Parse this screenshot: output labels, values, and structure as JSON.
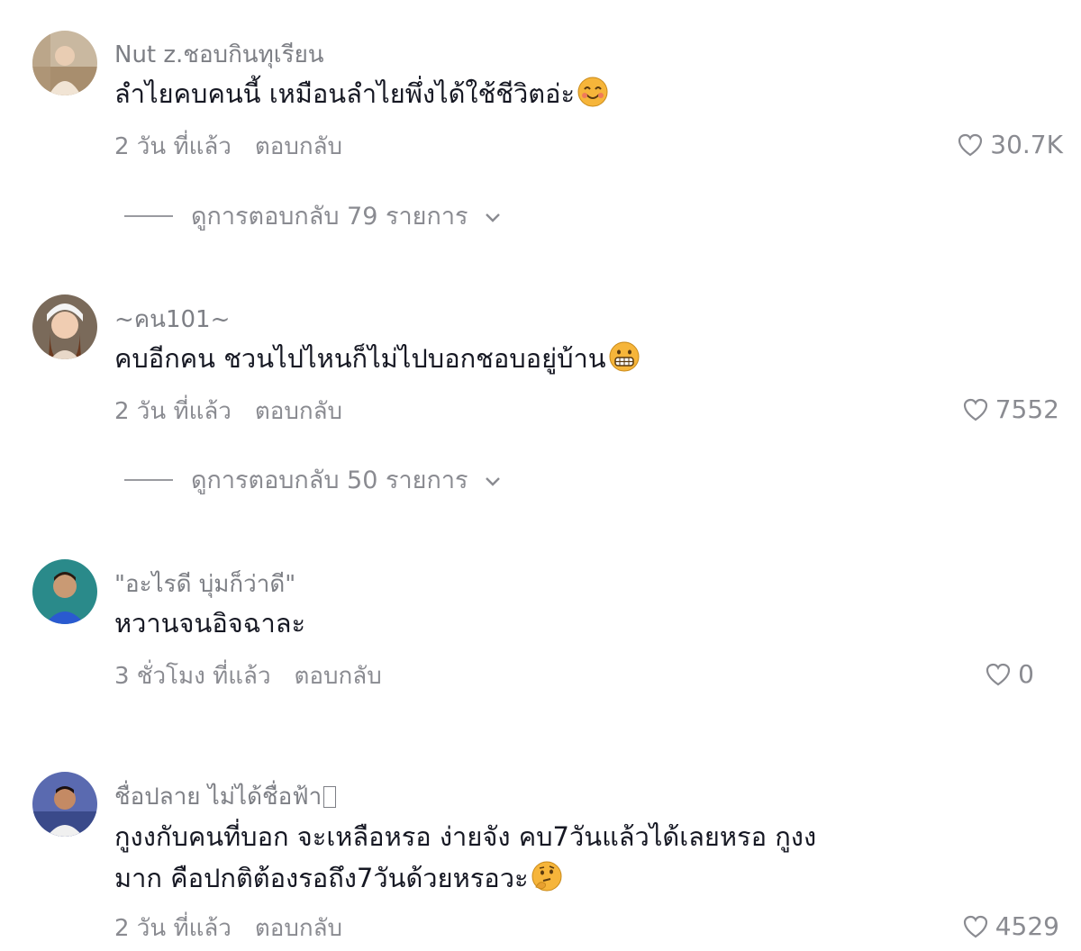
{
  "comments": [
    {
      "username": "Nut z.ชอบกินทุเรียน",
      "text": "ลำไยคบคนนี้ เหมือนลำไยพึ่งได้ใช้ชีวิตอ่ะ",
      "emoji": "smiling-face-with-hearts-icon",
      "time": "2 วัน ที่แล้ว",
      "reply_label": "ตอบกลับ",
      "likes": "30.7K",
      "view_replies": "ดูการตอบกลับ 79 รายการ"
    },
    {
      "username": "~คน101~",
      "text": "คบอีกคน ชวนไปไหนก็ไม่ไปบอกชอบอยู่บ้าน",
      "emoji": "grimacing-face-icon",
      "time": "2 วัน ที่แล้ว",
      "reply_label": "ตอบกลับ",
      "likes": "7552",
      "view_replies": "ดูการตอบกลับ 50 รายการ"
    },
    {
      "username": "\"อะไรดี บุ่มก็ว่าดี\"",
      "text": "หวานจนอิจฉาละ",
      "time": "3 ชั่วโมง ที่แล้ว",
      "reply_label": "ตอบกลับ",
      "likes": "0"
    },
    {
      "username": "ชื่อปลาย ไม่ได้ชื่อฟ้า",
      "text_line1": "กูงงกับคนที่บอก จะเหลือหรอ ง่ายจัง คบ7วันแล้วได้เลยหรอ กูงง",
      "text_line2": "มาก คือปกติต้องรอถึง7วันด้วยหรอวะ",
      "emoji": "thinking-face-icon",
      "time": "2 วัน ที่แล้ว",
      "reply_label": "ตอบกลับ",
      "likes": "4529"
    }
  ],
  "colors": {
    "text": "#161823",
    "muted": "#8a8b91",
    "emoji": "#f6b53a"
  }
}
